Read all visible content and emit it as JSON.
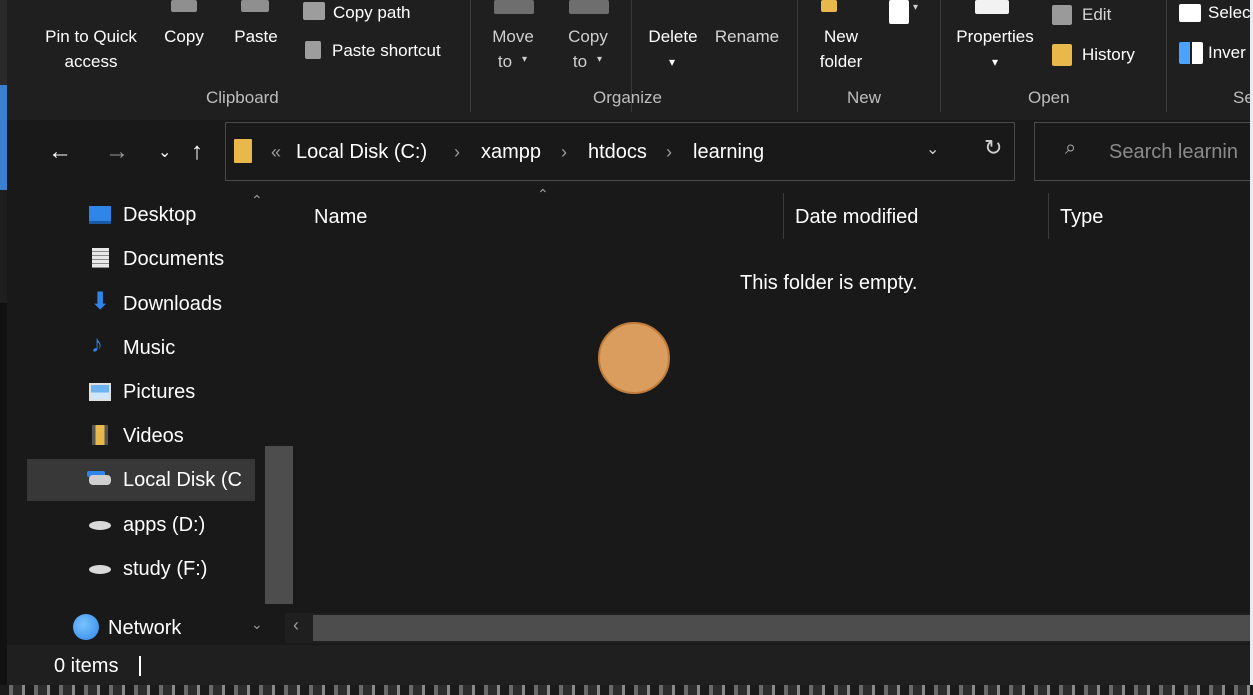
{
  "ribbon": {
    "clipboard": {
      "pin_label_1": "Pin to Quick",
      "pin_label_2": "access",
      "copy": "Copy",
      "paste": "Paste",
      "copy_path": "Copy path",
      "paste_shortcut": "Paste shortcut",
      "group": "Clipboard"
    },
    "organize": {
      "move_to_1": "Move",
      "move_to_2": "to",
      "copy_to_1": "Copy",
      "copy_to_2": "to",
      "delete": "Delete",
      "rename": "Rename",
      "group": "Organize"
    },
    "new": {
      "new_folder_1": "New",
      "new_folder_2": "folder",
      "group": "New"
    },
    "open": {
      "properties": "Properties",
      "edit": "Edit",
      "history": "History",
      "group": "Open"
    },
    "select": {
      "select_all": "Selec",
      "invert": "Inver",
      "group": "Se"
    }
  },
  "address": {
    "overflow": "«",
    "crumbs": [
      "Local Disk (C:)",
      "xampp",
      "htdocs",
      "learning"
    ],
    "separator": "›"
  },
  "search": {
    "placeholder": "Search learnin"
  },
  "nav_pane": {
    "items": [
      {
        "label": "Desktop",
        "icon": "desktop-icon"
      },
      {
        "label": "Documents",
        "icon": "documents-icon"
      },
      {
        "label": "Downloads",
        "icon": "downloads-icon"
      },
      {
        "label": "Music",
        "icon": "music-icon"
      },
      {
        "label": "Pictures",
        "icon": "pictures-icon"
      },
      {
        "label": "Videos",
        "icon": "videos-icon"
      },
      {
        "label": "Local Disk (C",
        "icon": "local-disk-icon",
        "selected": true
      },
      {
        "label": "apps (D:)",
        "icon": "drive-icon"
      },
      {
        "label": "study (F:)",
        "icon": "drive-icon"
      },
      {
        "label": "Network",
        "icon": "network-icon"
      }
    ]
  },
  "file_list": {
    "columns": [
      "Name",
      "Date modified",
      "Type"
    ],
    "empty_message": "This folder is empty."
  },
  "status_bar": {
    "items_count": "0 items"
  },
  "colors": {
    "window_bg": "#191919",
    "ribbon_bg": "#1f1f1f",
    "selection_bg": "#383838",
    "click_indicator": "#e5a561"
  }
}
